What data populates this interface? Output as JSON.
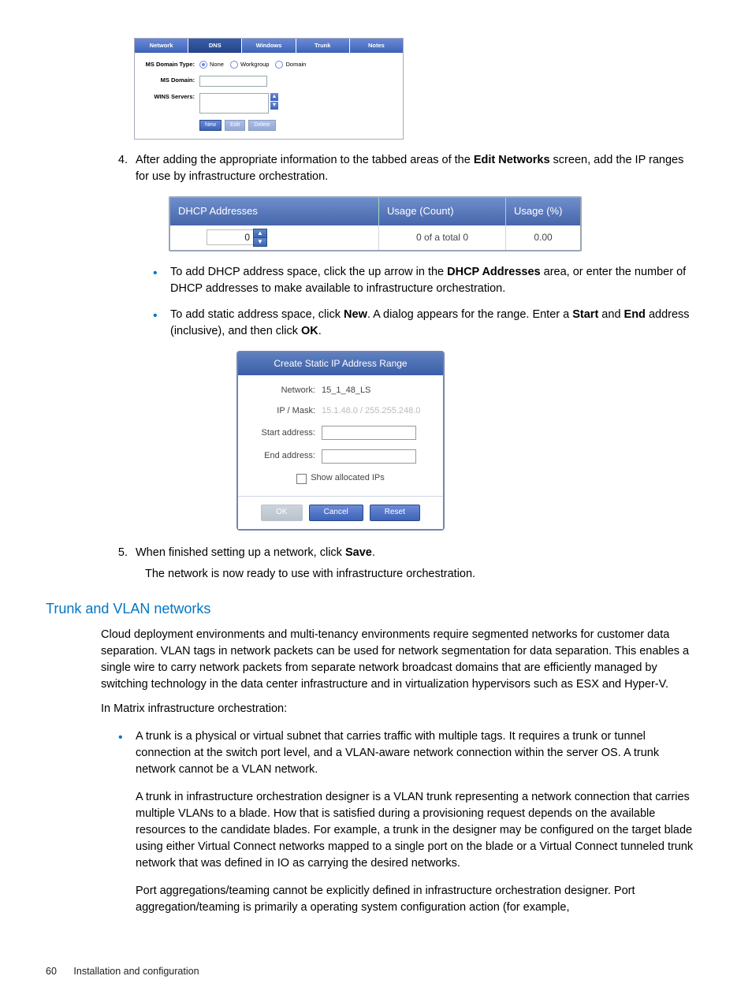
{
  "footer": {
    "page_number": "60",
    "section": "Installation and configuration"
  },
  "fig1": {
    "tabs": [
      "Network",
      "DNS",
      "Windows",
      "Trunk",
      "Notes"
    ],
    "active_tab_index": 1,
    "domain_type_label": "MS Domain Type:",
    "radios": [
      "None",
      "Workgroup",
      "Domain"
    ],
    "selected_radio_index": 0,
    "ms_domain_label": "MS Domain:",
    "wins_label": "WINS Servers:",
    "buttons": {
      "new": "New",
      "edit": "Edit",
      "delete": "Delete"
    }
  },
  "step4": {
    "lead": "After adding the appropriate information to the tabbed areas of the ",
    "bold": "Edit Networks",
    "tail": " screen, add the IP ranges for use by infrastructure orchestration."
  },
  "fig2": {
    "headers": {
      "c1": "DHCP Addresses",
      "c2": "Usage (Count)",
      "c3": "Usage (%)"
    },
    "row": {
      "spinner": "0",
      "count": "0 of a total 0",
      "pct": "0.00"
    }
  },
  "bullets4": {
    "b1a": "To add DHCP address space, click the up arrow in the ",
    "b1b": "DHCP Addresses",
    "b1c": " area, or enter the number of DHCP addresses to make available to infrastructure orchestration.",
    "b2a": "To add static address space, click ",
    "b2b": "New",
    "b2c": ". A dialog appears for the range. Enter a ",
    "b2d": "Start",
    "b2e": " and ",
    "b2f": "End",
    "b2g": " address (inclusive), and then click ",
    "b2h": "OK",
    "b2i": "."
  },
  "fig3": {
    "title": "Create Static IP Address Range",
    "rows": {
      "network_label": "Network:",
      "network_value": "15_1_48_LS",
      "mask_label": "IP / Mask:",
      "mask_value": "15.1.48.0 / 255.255.248.0",
      "start_label": "Start address:",
      "end_label": "End address:"
    },
    "show_allocated": "Show allocated IPs",
    "buttons": {
      "ok": "OK",
      "cancel": "Cancel",
      "reset": "Reset"
    }
  },
  "step5": {
    "lead": "When finished setting up a network, click ",
    "bold": "Save",
    "tail": ".",
    "after": "The network is now ready to use with infrastructure orchestration."
  },
  "section_heading": "Trunk and VLAN networks",
  "section": {
    "p1": "Cloud deployment environments and multi-tenancy environments require segmented networks for customer data separation. VLAN tags in network packets can be used for network segmentation for data separation. This enables a single wire to carry network packets from separate network broadcast domains that are efficiently managed by switching technology in the data center infrastructure and in virtualization hypervisors such as ESX and Hyper-V.",
    "p2": "In Matrix infrastructure orchestration:",
    "b1": "A trunk is a physical or virtual subnet that carries traffic with multiple tags. It requires a trunk or tunnel connection at the switch port level, and a VLAN-aware network connection within the server OS. A trunk network cannot be a VLAN network.",
    "b1b": "A trunk in infrastructure orchestration designer is a VLAN trunk representing a network connection that carries multiple VLANs to a blade. How that is satisfied during a provisioning request depends on the available resources to the candidate blades. For example, a trunk in the designer may be configured on the target blade using either Virtual Connect networks mapped to a single port on the blade or a Virtual Connect tunneled trunk network that was defined in IO as carrying the desired networks.",
    "b1c": "Port aggregations/teaming cannot be explicitly defined in infrastructure orchestration designer. Port aggregation/teaming is primarily a operating system configuration action (for example,"
  }
}
